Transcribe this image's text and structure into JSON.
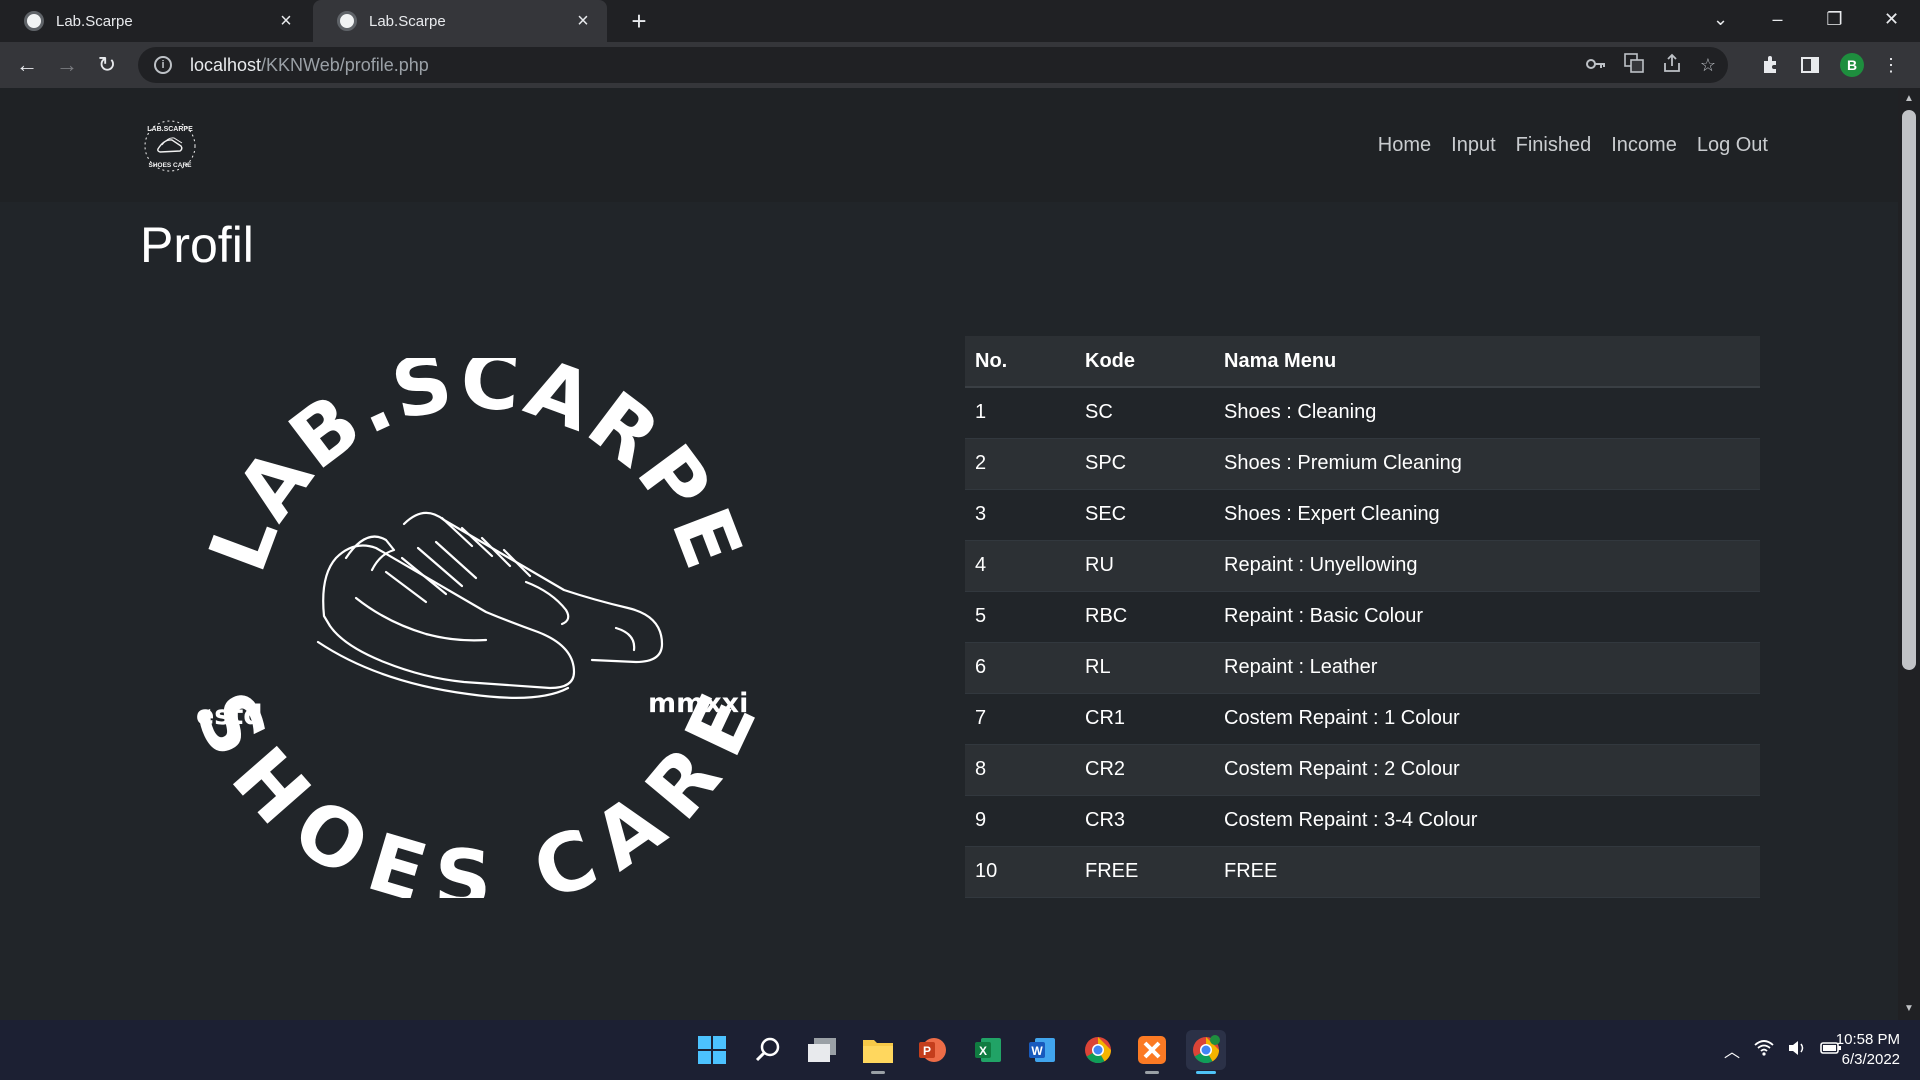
{
  "browser": {
    "tabs": [
      {
        "title": "Lab.Scarpe",
        "active": false
      },
      {
        "title": "Lab.Scarpe",
        "active": true
      }
    ],
    "url_host": "localhost",
    "url_path": "/KKNWeb/profile.php",
    "profile_initial": "B"
  },
  "navbar": {
    "links": [
      "Home",
      "Input",
      "Finished",
      "Income",
      "Log Out"
    ]
  },
  "page": {
    "title": "Profil"
  },
  "logo": {
    "top_text": "LAB.SCARPE",
    "bottom_text": "SHOES CARE",
    "left_text": "estd",
    "right_text": "mmxxi"
  },
  "table": {
    "headers": [
      "No.",
      "Kode",
      "Nama Menu"
    ],
    "rows": [
      [
        "1",
        "SC",
        "Shoes : Cleaning"
      ],
      [
        "2",
        "SPC",
        "Shoes : Premium Cleaning"
      ],
      [
        "3",
        "SEC",
        "Shoes : Expert Cleaning"
      ],
      [
        "4",
        "RU",
        "Repaint : Unyellowing"
      ],
      [
        "5",
        "RBC",
        "Repaint : Basic Colour"
      ],
      [
        "6",
        "RL",
        "Repaint : Leather"
      ],
      [
        "7",
        "CR1",
        "Costem Repaint : 1 Colour"
      ],
      [
        "8",
        "CR2",
        "Costem Repaint : 2 Colour"
      ],
      [
        "9",
        "CR3",
        "Costem Repaint : 3-4 Colour"
      ],
      [
        "10",
        "FREE",
        "FREE"
      ]
    ]
  },
  "taskbar": {
    "time": "10:58 PM",
    "date": "6/3/2022",
    "apps": [
      "start-icon",
      "search-icon",
      "task-view-icon",
      "file-explorer-icon",
      "powerpoint-icon",
      "excel-icon",
      "word-icon",
      "chrome-icon",
      "xampp-icon",
      "chrome-profile-icon"
    ]
  },
  "colors": {
    "page_bg": "#212529",
    "navbar_bg": "#1f2225",
    "table_stripe": "#2c3034",
    "chrome_dark": "#202124",
    "chrome_toolbar": "#35363a"
  }
}
